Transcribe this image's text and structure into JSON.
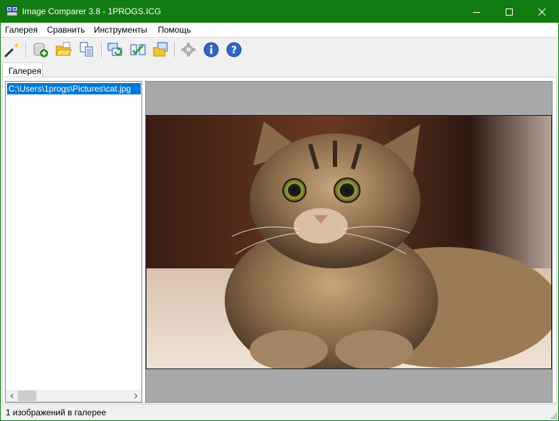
{
  "window": {
    "title": "Image Comparer 3.8 - 1PROGS.ICG"
  },
  "menu": {
    "items": [
      "Галерея",
      "Сравнить",
      "Инструменты",
      "Помощь"
    ]
  },
  "toolbar": {
    "buttons": [
      "magic-wand-icon",
      "add-database-icon",
      "open-folder-icon",
      "compare-files-icon",
      "refresh-compare-icon",
      "compare-pair-icon",
      "folders-icon",
      "settings-gear-icon",
      "info-icon",
      "help-icon"
    ]
  },
  "tabs": {
    "gallery": "Галерея"
  },
  "gallery_list": {
    "items": [
      "C:\\Users\\1progs\\Pictures\\cat.jpg"
    ]
  },
  "status": {
    "text": "1 изображений в галерее"
  },
  "colors": {
    "titlebar": "#127c13",
    "selection": "#0078d7",
    "preview_bg": "#a9a9a9"
  }
}
